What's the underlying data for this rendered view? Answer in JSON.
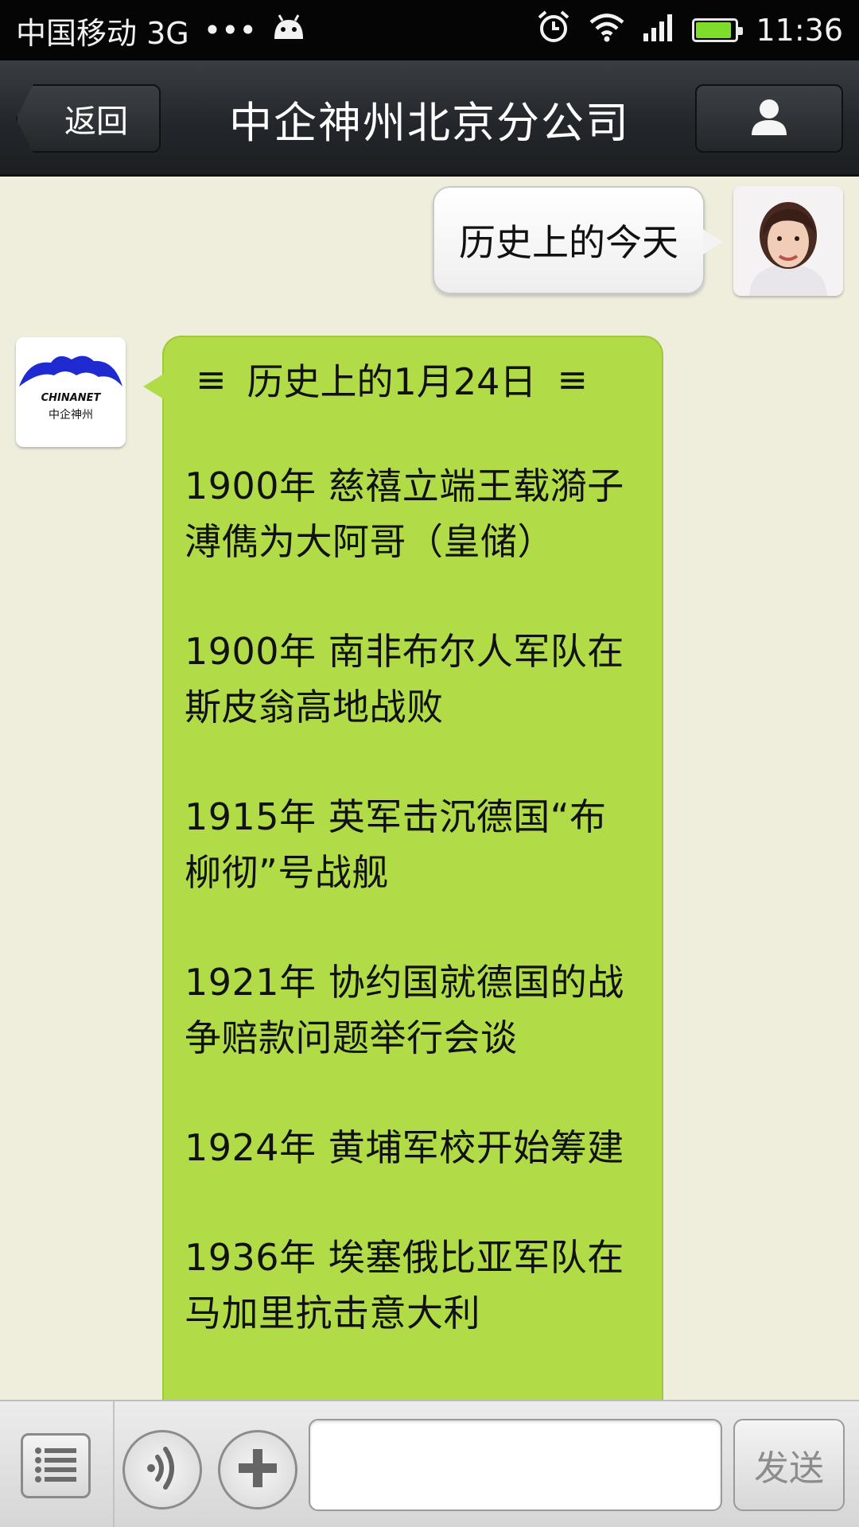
{
  "status_bar": {
    "carrier": "中国移动 3G",
    "dots": "•••",
    "time": "11:36",
    "battery_level": 0.9
  },
  "title_bar": {
    "back_label": "返回",
    "title": "中企神州北京分公司"
  },
  "messages": {
    "outgoing_text": "历史上的今天",
    "bot_logo_text": "CHINANET",
    "bot_logo_subtext": "中企神州",
    "incoming_header_left": "≡",
    "incoming_header_title": "历史上的1月24日",
    "incoming_header_right": "≡",
    "events": [
      "1900年 慈禧立端王载漪子溥儁为大阿哥（皇储）",
      "1900年 南非布尔人军队在斯皮翁高地战败",
      "1915年 英军击沉德国“布柳彻”号战舰",
      "1921年 协约国就德国的战争赔款问题举行会谈",
      "1924年 黄埔军校开始筹建",
      "1936年 埃塞俄比亚军队在马加里抗击意大利"
    ]
  },
  "input_bar": {
    "input_value": "",
    "send_label": "发送"
  },
  "colors": {
    "chat_background": "#efeedd",
    "incoming_bubble": "#b1dc47",
    "titlebar": "#23272b"
  }
}
